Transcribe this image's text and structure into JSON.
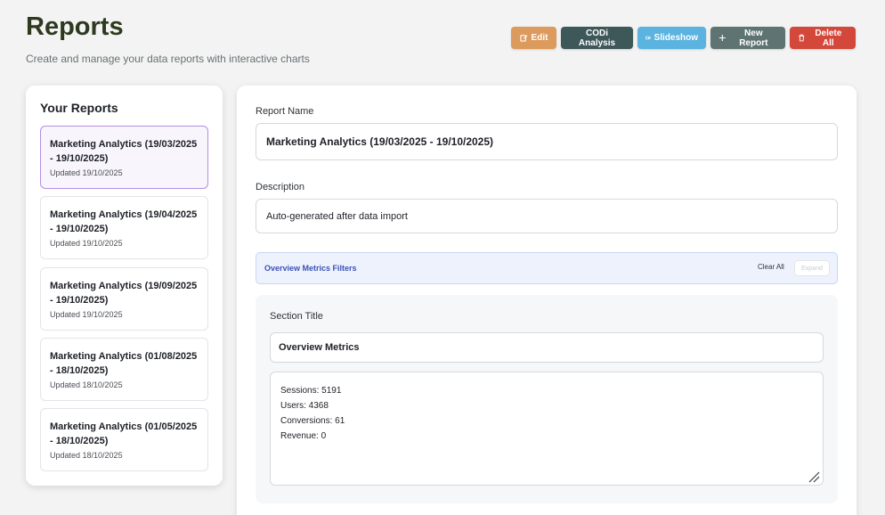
{
  "header": {
    "title": "Reports",
    "subtitle": "Create and manage your data reports with interactive charts"
  },
  "toolbar": {
    "buttons": [
      {
        "label": "Edit",
        "icon": "edit-icon",
        "color": "#dc9a5c"
      },
      {
        "label": "CODi Analysis",
        "icon": "",
        "color": "#3e5758"
      },
      {
        "label": "Slideshow",
        "icon": "video-icon",
        "color": "#5bb3e0"
      },
      {
        "label": "New Report",
        "icon": "plus-icon",
        "color": "#5f7472"
      },
      {
        "label": "Delete All",
        "icon": "trash-icon",
        "color": "#d4473b"
      }
    ]
  },
  "sidebar": {
    "title": "Your Reports",
    "reports": [
      {
        "name": "Marketing Analytics (19/03/2025 - 19/10/2025)",
        "updated": "Updated 19/10/2025",
        "active": true
      },
      {
        "name": "Marketing Analytics (19/04/2025 - 19/10/2025)",
        "updated": "Updated 19/10/2025",
        "active": false
      },
      {
        "name": "Marketing Analytics (19/09/2025 - 19/10/2025)",
        "updated": "Updated 19/10/2025",
        "active": false
      },
      {
        "name": "Marketing Analytics (01/08/2025 - 18/10/2025)",
        "updated": "Updated 18/10/2025",
        "active": false
      },
      {
        "name": "Marketing Analytics (01/05/2025 - 18/10/2025)",
        "updated": "Updated 18/10/2025",
        "active": false
      }
    ]
  },
  "form": {
    "name_label": "Report Name",
    "name_value": "Marketing Analytics (19/03/2025 - 19/10/2025)",
    "description_label": "Description",
    "description_value": "Auto-generated after data import",
    "filters": {
      "title": "Overview Metrics Filters",
      "clear_label": "Clear All",
      "expand_label": "Expand"
    },
    "section": {
      "title_label": "Section Title",
      "title_value": "Overview Metrics",
      "content": "Sessions: 5191\nUsers: 4368\nConversions: 61\nRevenue: 0"
    }
  }
}
